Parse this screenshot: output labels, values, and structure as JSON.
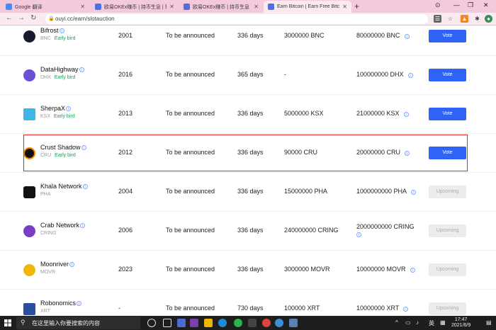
{
  "tabs": [
    {
      "title": "Google 翻译",
      "favicon_color": "#4a8af4",
      "active": false
    },
    {
      "title": "欧易OKEx赚币 | 持币生息 | 理财",
      "favicon_color": "#4d6fe0",
      "active": false
    },
    {
      "title": "欧易OKEx赚币 | 持币生息 | 理财",
      "favicon_color": "#4d6fe0",
      "active": false
    },
    {
      "title": "Earn Bitcoin | Earn Free Bitcoin",
      "favicon_color": "#4d6fe0",
      "active": true
    }
  ],
  "address_bar": {
    "url": "ouyi.cc/earn/slotauction"
  },
  "rows": [
    {
      "name": "Bifrost",
      "symbol": "BNC",
      "badge": "Early bird",
      "parachain": "2001",
      "date": "To be announced",
      "days": "336 days",
      "amount": "3000000 BNC",
      "cap": "80000000 BNC",
      "cap_info": true,
      "action": "Vote",
      "action_type": "vote",
      "logo_color": "#1a1a2e"
    },
    {
      "name": "DataHighway",
      "symbol": "DHX",
      "badge": "Early bird",
      "parachain": "2016",
      "date": "To be announced",
      "days": "365 days",
      "amount": "-",
      "cap": "100000000 DHX",
      "cap_info": true,
      "action": "Vote",
      "action_type": "vote",
      "logo_color": "#6a4fd8"
    },
    {
      "name": "SherpaX",
      "symbol": "KSX",
      "badge": "Early bird",
      "parachain": "2013",
      "date": "To be announced",
      "days": "336 days",
      "amount": "5000000 KSX",
      "cap": "21000000 KSX",
      "cap_info": true,
      "action": "Vote",
      "action_type": "vote",
      "logo_color": "#3fb6e8"
    },
    {
      "name": "Crust Shadow",
      "symbol": "CRU",
      "badge": "Early bird",
      "parachain": "2012",
      "date": "To be announced",
      "days": "336 days",
      "amount": "90000 CRU",
      "cap": "20000000 CRU",
      "cap_info": true,
      "action": "Vote",
      "action_type": "vote",
      "logo_color": "#111111"
    },
    {
      "name": "Khala Network",
      "symbol": "PHA",
      "badge": "",
      "parachain": "2004",
      "date": "To be announced",
      "days": "336 days",
      "amount": "15000000 PHA",
      "cap": "1000000000 PHA",
      "cap_info": true,
      "action": "Upcoming",
      "action_type": "upcoming",
      "logo_color": "#111111"
    },
    {
      "name": "Crab Network",
      "symbol": "CRING",
      "badge": "",
      "parachain": "2006",
      "date": "To be announced",
      "days": "336 days",
      "amount": "240000000 CRING",
      "cap": "2000000000 CRING",
      "cap_info": true,
      "action": "Upcoming",
      "action_type": "upcoming",
      "logo_color": "#7a3fc4"
    },
    {
      "name": "Moonriver",
      "symbol": "MOVR",
      "badge": "",
      "parachain": "2023",
      "date": "To be announced",
      "days": "336 days",
      "amount": "3000000 MOVR",
      "cap": "10000000 MOVR",
      "cap_info": true,
      "action": "Upcoming",
      "action_type": "upcoming",
      "logo_color": "#f2b705"
    },
    {
      "name": "Robonomics",
      "symbol": "XRT",
      "badge": "",
      "parachain": "-",
      "date": "To be announced",
      "days": "730 days",
      "amount": "100000 XRT",
      "cap": "10000000 XRT",
      "cap_info": true,
      "action": "Upcoming",
      "action_type": "upcoming",
      "logo_color": "#2a4fa0"
    }
  ],
  "taskbar": {
    "search_placeholder": "在这里输入你要搜索的内容",
    "ime": "英",
    "time": "17:47",
    "date": "2021/6/9"
  },
  "colors": {
    "accent": "#2f63f6",
    "highlight_border": "#e22222",
    "early_bird": "#1aa05a"
  }
}
